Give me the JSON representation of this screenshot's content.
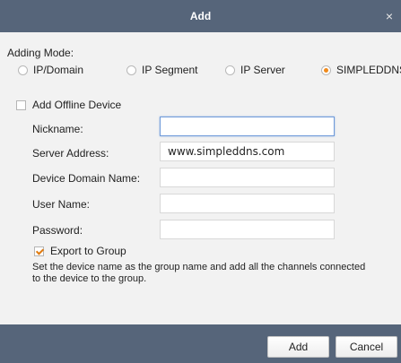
{
  "dialog": {
    "title": "Add",
    "close_glyph": "×"
  },
  "adding_mode": {
    "label": "Adding Mode:",
    "options": [
      {
        "label": "IP/Domain",
        "checked": false
      },
      {
        "label": "IP Segment",
        "checked": false
      },
      {
        "label": "IP Server",
        "checked": false
      },
      {
        "label": "SIMPLEDDNS",
        "checked": true
      }
    ]
  },
  "offline_device": {
    "label": "Add Offline Device",
    "checked": false
  },
  "fields": {
    "nickname": {
      "label": "Nickname:",
      "value": ""
    },
    "server_address": {
      "label": "Server Address:",
      "value": "www.simpleddns.com"
    },
    "device_domain_name": {
      "label": "Device Domain Name:",
      "value": ""
    },
    "user_name": {
      "label": "User Name:",
      "value": ""
    },
    "password": {
      "label": "Password:",
      "value": ""
    }
  },
  "export_to_group": {
    "label": "Export to Group",
    "checked": true,
    "description": "Set the device name as the group name and add all the channels connected to the device to the group."
  },
  "buttons": {
    "add": "Add",
    "cancel": "Cancel"
  },
  "colors": {
    "titlebar": "#56657a",
    "accent": "#f08a1c",
    "focus_border": "#6f9ad9"
  }
}
